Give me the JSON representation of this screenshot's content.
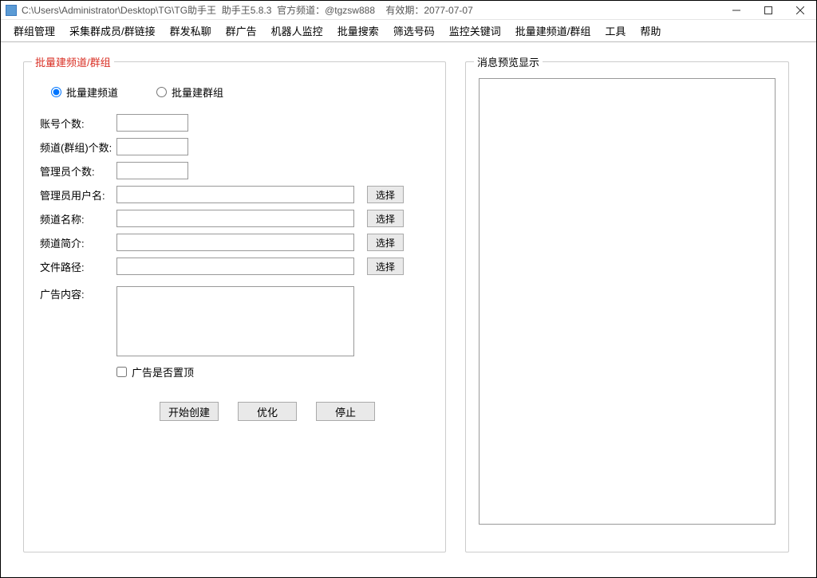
{
  "titlebar": {
    "path": "C:\\Users\\Administrator\\Desktop\\TG\\TG助手王",
    "appname": "助手王5.8.3",
    "channel_label": "官方频道：",
    "channel": "@tgzsw888",
    "expiry_label": "有效期：",
    "expiry": "2077-07-07"
  },
  "menu": {
    "items": [
      "群组管理",
      "采集群成员/群链接",
      "群发私聊",
      "群广告",
      "机器人监控",
      "批量搜索",
      "筛选号码",
      "监控关键词",
      "批量建频道/群组",
      "工具",
      "帮助"
    ]
  },
  "left_panel": {
    "title": "批量建频道/群组",
    "radio_channel": "批量建频道",
    "radio_group": "批量建群组",
    "fields": {
      "account_count": "账号个数:",
      "channel_count": "频道(群组)个数:",
      "admin_count": "管理员个数:",
      "admin_username": "管理员用户名:",
      "channel_name": "频道名称:",
      "channel_desc": "频道简介:",
      "file_path": "文件路径:",
      "ad_content": "广告内容:"
    },
    "values": {
      "account_count": "",
      "channel_count": "",
      "admin_count": "",
      "admin_username": "",
      "channel_name": "",
      "channel_desc": "",
      "file_path": "",
      "ad_content": ""
    },
    "select_label": "选择",
    "checkbox_pin": "广告是否置顶",
    "buttons": {
      "start": "开始创建",
      "optimize": "优化",
      "stop": "停止"
    }
  },
  "right_panel": {
    "title": "消息预览显示"
  }
}
